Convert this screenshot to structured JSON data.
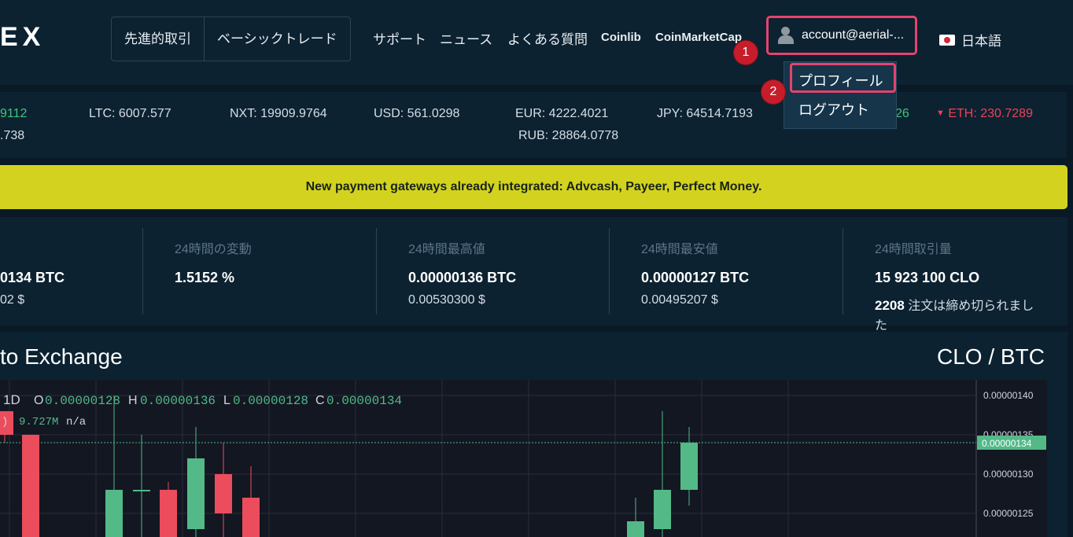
{
  "header": {
    "logo": "EX",
    "modes": [
      "先進的取引",
      "ベーシックトレード"
    ],
    "nav": [
      "サポート",
      "ニュース",
      "よくある質問",
      "Coinlib",
      "CoinMarketCap"
    ],
    "account_label": "account@aerial-...",
    "language": "日本語"
  },
  "annotations": {
    "step1": "1",
    "step2": "2"
  },
  "dropdown": {
    "profile": "プロフィール",
    "logout": "ログアウト"
  },
  "ticker": {
    "first_top": "9112",
    "first_bottom": ".738",
    "ltc": "LTC: 6007.577",
    "nxt": "NXT: 19909.9764",
    "usd": "USD: 561.0298",
    "eur": "EUR: 4222.4021",
    "rub": "RUB: 28864.0778",
    "jpy": "JPY: 64514.7193",
    "partial": "26",
    "eth": "ETH: 230.7289"
  },
  "banner": "New payment gateways already integrated: Advcash, Payeer, Perfect Money.",
  "stats": {
    "last_main": "0134 BTC",
    "last_sub": "02 $",
    "change_label": "24時間の変動",
    "change_value": "1.5152 %",
    "high_label": "24時間最高値",
    "high_main": "0.00000136 BTC",
    "high_sub": "0.00530300 $",
    "low_label": "24時間最安値",
    "low_main": "0.00000127 BTC",
    "low_sub": "0.00495207 $",
    "volume_label": "24時間取引量",
    "volume_main": "15 923 100 CLO",
    "orders_count": "2208",
    "orders_text": "注文は締め切られまし",
    "orders_text2": "た"
  },
  "chart_header": {
    "title": "to Exchange",
    "pair": "CLO / BTC"
  },
  "chart_legend": {
    "interval": "1D",
    "o_label": "O",
    "o_value": "0.00000128",
    "h_label": "H",
    "h_value": "0.00000136",
    "l_label": "L",
    "l_value": "0.00000128",
    "c_label": "C",
    "c_value": "0.00000134",
    "vol_prefix": ")",
    "vol_value": "9.727M",
    "vol_na": "n/a"
  },
  "chart_data": {
    "type": "candlestick",
    "y_ticks": [
      "0.00000140",
      "0.00000135",
      "0.00000130",
      "0.00000125"
    ],
    "current_price": "0.00000134",
    "ylim": [
      1.22e-06,
      1.42e-06
    ],
    "candles": [
      {
        "o": 1.38e-06,
        "h": 1.38e-06,
        "l": 1.34e-06,
        "c": 1.35e-06,
        "dir": "down"
      },
      {
        "o": 1.35e-06,
        "h": 1.35e-06,
        "l": 1.2e-06,
        "c": 1.2e-06,
        "dir": "down"
      },
      {
        "o": 1.22e-06,
        "h": 1.4e-06,
        "l": 1.2e-06,
        "c": 1.28e-06,
        "dir": "up"
      },
      {
        "o": 1.28e-06,
        "h": 1.35e-06,
        "l": 1.22e-06,
        "c": 1.28e-06,
        "dir": "up"
      },
      {
        "o": 1.28e-06,
        "h": 1.29e-06,
        "l": 1.2e-06,
        "c": 1.22e-06,
        "dir": "down"
      },
      {
        "o": 1.23e-06,
        "h": 1.36e-06,
        "l": 1.2e-06,
        "c": 1.32e-06,
        "dir": "up"
      },
      {
        "o": 1.3e-06,
        "h": 1.34e-06,
        "l": 1.2e-06,
        "c": 1.25e-06,
        "dir": "down"
      },
      {
        "o": 1.27e-06,
        "h": 1.31e-06,
        "l": 1.2e-06,
        "c": 1.22e-06,
        "dir": "down"
      },
      {
        "o": 1.24e-06,
        "h": 1.27e-06,
        "l": 1.2e-06,
        "c": 1.21e-06,
        "dir": "up"
      },
      {
        "o": 1.23e-06,
        "h": 1.38e-06,
        "l": 1.2e-06,
        "c": 1.28e-06,
        "dir": "up"
      },
      {
        "o": 1.28e-06,
        "h": 1.36e-06,
        "l": 1.26e-06,
        "c": 1.34e-06,
        "dir": "up"
      }
    ]
  },
  "colors": {
    "up": "#53b987",
    "down": "#eb4d5c",
    "accent": "#e5436d",
    "banner": "#d3d31f"
  }
}
